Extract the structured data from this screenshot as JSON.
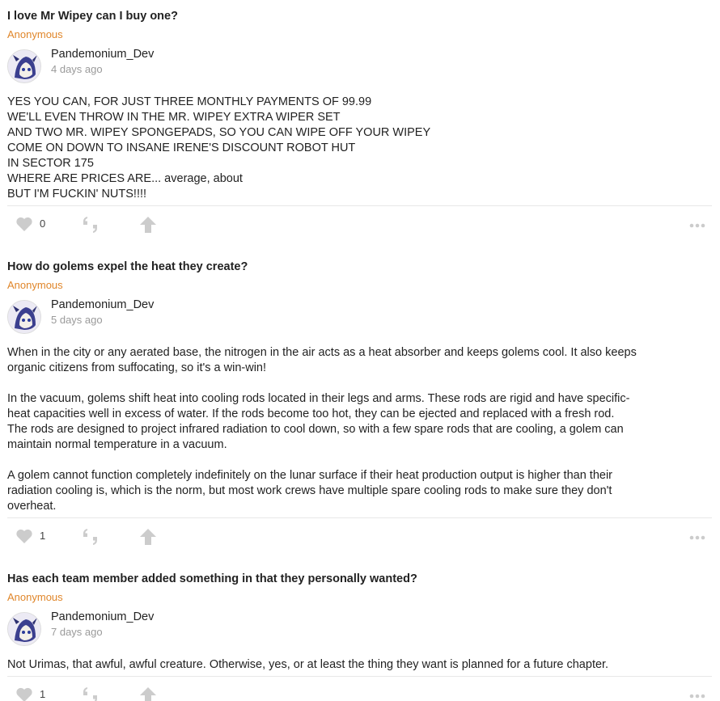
{
  "posts": [
    {
      "question": "I love Mr Wipey can I buy one?",
      "asker": "Anonymous",
      "author": "Pandemonium_Dev",
      "time": "4 days ago",
      "answer_lines": [
        "YES YOU CAN, FOR JUST THREE MONTHLY PAYMENTS OF 99.99",
        "WE'LL EVEN THROW IN THE MR. WIPEY EXTRA WIPER SET",
        "AND TWO MR. WIPEY SPONGEPADS, SO YOU CAN WIPE OFF YOUR WIPEY",
        "COME ON DOWN TO INSANE IRENE'S DISCOUNT ROBOT HUT",
        "IN SECTOR 175",
        "WHERE ARE PRICES ARE... average, about",
        "BUT I'M FUCKIN' NUTS!!!!"
      ],
      "likes": "0"
    },
    {
      "question": "How do golems expel the heat they create?",
      "asker": "Anonymous",
      "author": "Pandemonium_Dev",
      "time": "5 days ago",
      "answer_paragraphs": [
        [
          "When in the city or any aerated base, the nitrogen in the air acts as a heat absorber and keeps golems cool. It also keeps",
          "organic citizens from suffocating, so it's a win-win!"
        ],
        [
          "In the vacuum, golems shift heat into cooling rods located in their legs and arms. These rods are rigid and have specific-",
          "heat capacities well in excess of water. If the rods become too hot, they can be ejected and replaced with a fresh rod.",
          "The rods are designed to project infrared radiation to cool down, so with a few spare rods that are cooling, a golem can",
          "maintain normal temperature in a vacuum."
        ],
        [
          "A golem cannot function completely indefinitely on the lunar surface if their heat production output is higher than their",
          "radiation cooling is, which is the norm, but most work crews have multiple spare cooling rods to make sure they don't",
          "overheat."
        ]
      ],
      "likes": "1"
    },
    {
      "question": "Has each team member added something in that they personally wanted?",
      "asker": "Anonymous",
      "author": "Pandemonium_Dev",
      "time": "7 days ago",
      "answer_lines": [
        "Not Urimas, that awful, awful creature. Otherwise, yes, or at least the thing they want is planned for a future chapter."
      ],
      "likes": "1"
    }
  ],
  "icons": {
    "like": "heart-icon",
    "quote": "quote-icon",
    "upvote": "upvote-arrow-icon",
    "more": "more-dots-icon"
  },
  "colors": {
    "asker": "#e0862a",
    "icon": "#cccccc",
    "time": "#9a9a9a"
  }
}
